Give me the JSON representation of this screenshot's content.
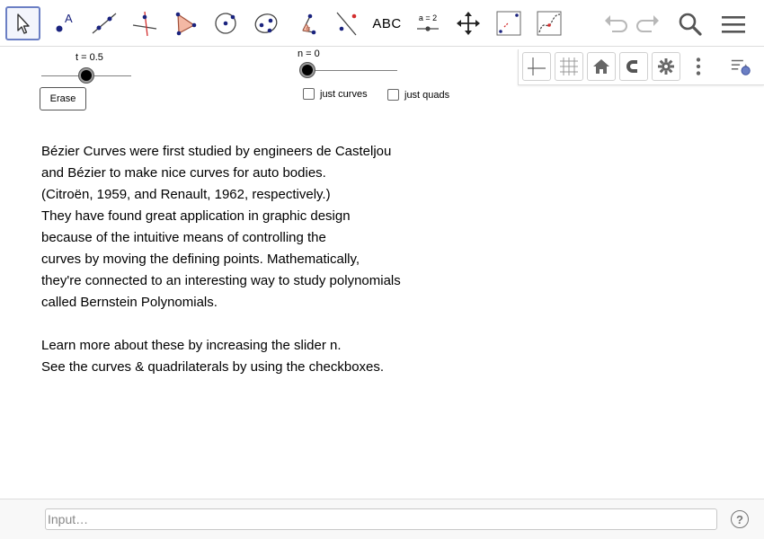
{
  "toolbar": {
    "tools": [
      {
        "name": "move-tool",
        "icon": "arrow-pointer-icon"
      },
      {
        "name": "point-tool",
        "icon": "point-icon",
        "label": "A"
      },
      {
        "name": "line-tool",
        "icon": "line-icon"
      },
      {
        "name": "perpendicular-tool",
        "icon": "perpendicular-icon"
      },
      {
        "name": "polygon-tool",
        "icon": "polygon-icon"
      },
      {
        "name": "circle-tool",
        "icon": "circle-icon"
      },
      {
        "name": "conic-tool",
        "icon": "ellipse-icon"
      },
      {
        "name": "angle-tool",
        "icon": "angle-icon"
      },
      {
        "name": "reflect-tool",
        "icon": "reflect-icon"
      },
      {
        "name": "text-tool",
        "icon": "text-icon",
        "label": "ABC"
      },
      {
        "name": "slider-tool",
        "icon": "slider-icon",
        "label": "a = 2"
      },
      {
        "name": "move-view-tool",
        "icon": "move-arrows-icon"
      },
      {
        "name": "graphics-view-tool",
        "icon": "graphics-view-icon"
      },
      {
        "name": "function-tool",
        "icon": "function-icon"
      }
    ],
    "right": [
      "undo-icon",
      "redo-icon",
      "search-icon",
      "menu-icon"
    ]
  },
  "stylebar": {
    "buttons": [
      "axes-icon",
      "grid-icon",
      "home-icon",
      "magnet-icon",
      "gear-icon",
      "more-vert-icon",
      "style-bar-toggle-icon"
    ]
  },
  "slider_t": {
    "label": "t = 0.5",
    "value": 0.5,
    "min": 0,
    "max": 1
  },
  "slider_n": {
    "label": "n = 0",
    "value": 0,
    "min": 0,
    "max": 10
  },
  "erase_label": "Erase",
  "checkboxes": [
    {
      "label": "just curves",
      "checked": false
    },
    {
      "label": "just quads",
      "checked": false
    }
  ],
  "text_lines": [
    "Bézier Curves were first studied by engineers de Casteljou",
    "and Bézier to make nice curves for auto bodies.",
    "(Citroën, 1959, and Renault, 1962, respectively.)",
    "They have found great application in graphic design",
    "because of the intuitive means of controlling the",
    "curves by moving the defining points. Mathematically,",
    "they're connected to an interesting way to study polynomials",
    "called Bernstein Polynomials.",
    "",
    "Learn more about these by increasing the slider n.",
    "See the curves & quadrilaterals by using the checkboxes."
  ],
  "input": {
    "placeholder": "Input…",
    "value": ""
  },
  "help_label": "?",
  "colors": {
    "accent": "#6b7fc4",
    "point": "#1a237e",
    "red": "#d32f2f"
  }
}
